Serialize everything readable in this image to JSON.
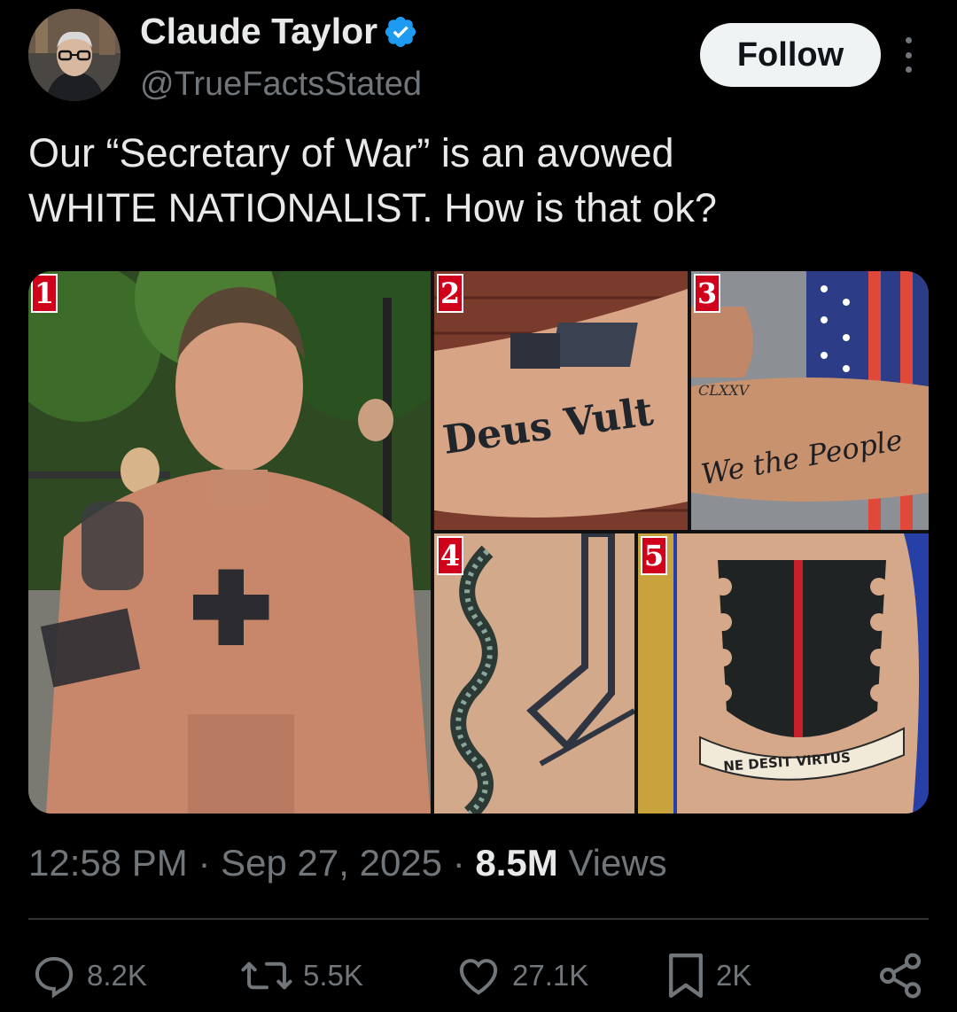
{
  "author": {
    "name": "Claude Taylor",
    "handle": "@TrueFactsStated",
    "verified": true
  },
  "follow_label": "Follow",
  "post": {
    "line1": "Our “Secretary of War” is an avowed",
    "line2": "WHITE NATIONALIST. How is that ok?"
  },
  "media": {
    "panel_numbers": [
      "1",
      "2",
      "3",
      "4",
      "5"
    ],
    "tattoo_texts": [
      "Deus Vult",
      "We the People",
      "CLXXV",
      "NE DESIT VIRTUS"
    ]
  },
  "meta": {
    "time": "12:58 PM",
    "sep": "·",
    "date": "Sep 27, 2025",
    "views_count": "8.5M",
    "views_label": "Views"
  },
  "actions": {
    "replies": "8.2K",
    "reposts": "5.5K",
    "likes": "27.1K",
    "bookmarks": "2K"
  },
  "icons": {
    "reply": "reply-icon",
    "repost": "repost-icon",
    "like": "heart-icon",
    "bookmark": "bookmark-icon",
    "share": "share-icon",
    "verified": "verified-badge-icon",
    "more": "more-icon"
  },
  "colors": {
    "background": "#000000",
    "text": "#e7e9ea",
    "muted": "#71767b",
    "verified_blue": "#1d9bf0",
    "number_badge": "#d0021b"
  }
}
